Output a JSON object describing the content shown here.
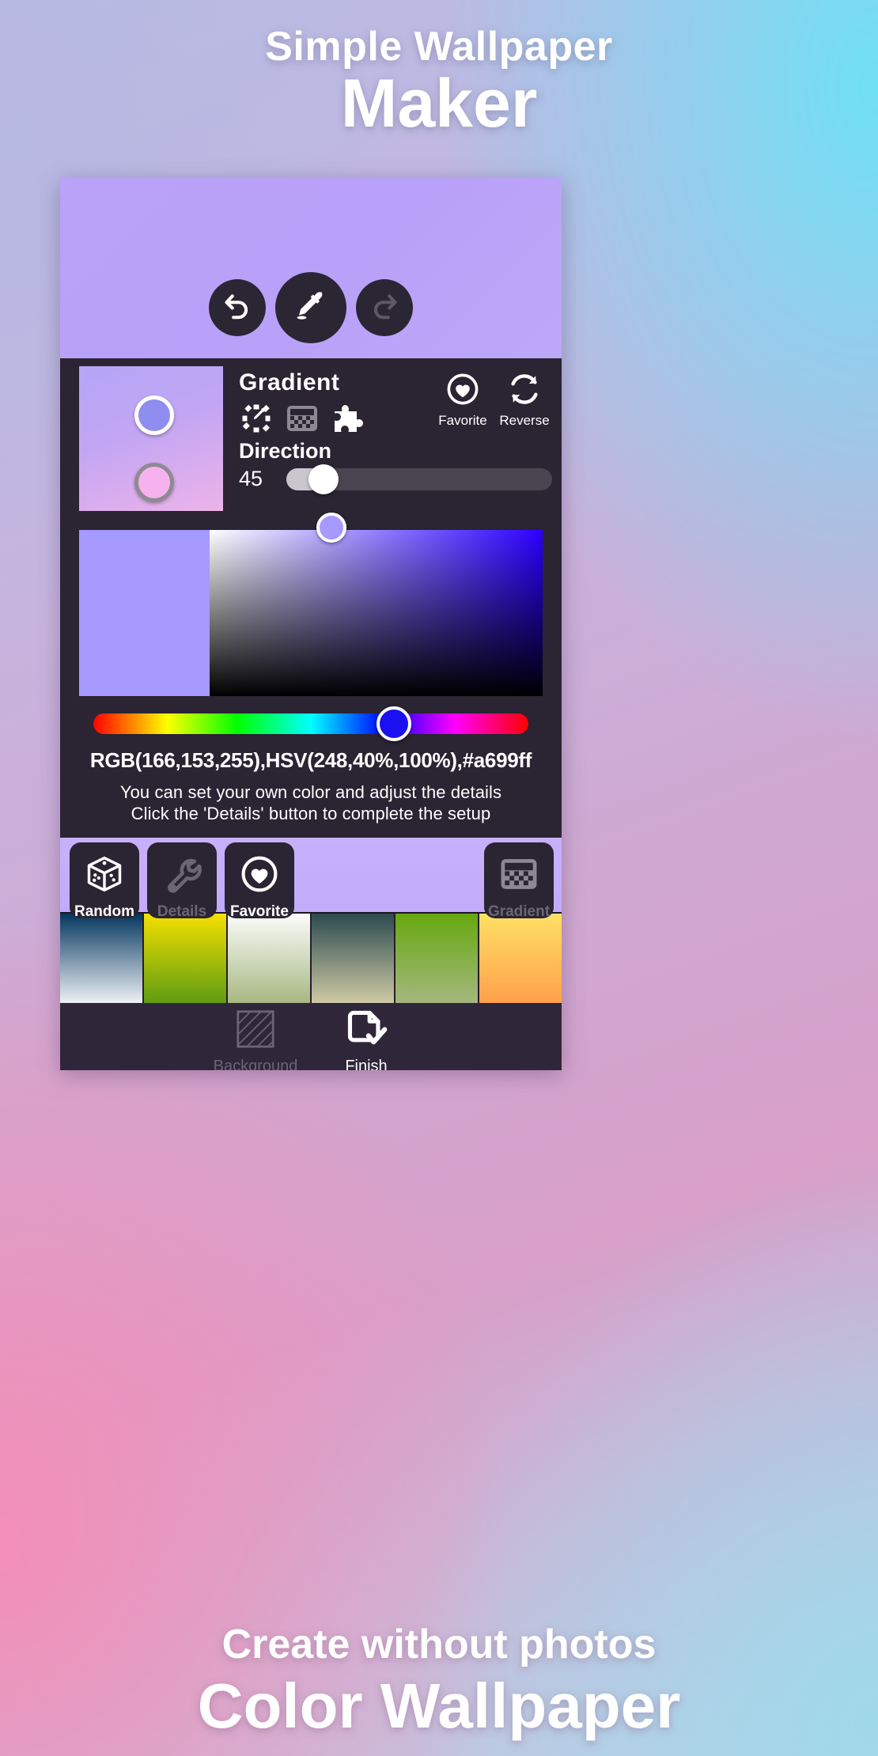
{
  "promo": {
    "heading_line1": "Simple Wallpaper",
    "heading_line2": "Maker",
    "footer_line1": "Create without photos",
    "footer_line2": "Color Wallpaper"
  },
  "preview": {
    "undo_icon": "undo-icon",
    "eyedropper_icon": "eyedropper-icon",
    "redo_icon": "redo-icon",
    "gradient_start": "#b9a2f7",
    "gradient_end": "#bda8f8"
  },
  "gradient_panel": {
    "title": "Gradient",
    "preview_start": "#b3a5f6",
    "preview_mid": "#c3a6f3",
    "preview_end": "#edb3e9",
    "stops": [
      {
        "name": "stop-color-1",
        "color": "#8f8df0",
        "selected": true
      },
      {
        "name": "stop-color-2",
        "color": "#f6b2ef",
        "selected": false
      }
    ],
    "mode_icons": [
      "color-wheel-picker-icon",
      "checkerboard-icon",
      "puzzle-piece-icon"
    ],
    "actions": [
      {
        "label": "Favorite",
        "icon": "heart-circle-icon"
      },
      {
        "label": "Reverse",
        "icon": "reverse-arrows-icon"
      }
    ],
    "direction": {
      "label": "Direction",
      "value": "45",
      "percent": 14
    }
  },
  "color_picker": {
    "current_color": "#a699ff",
    "sv_knob_x_percent": 32,
    "hue_knob_percent": 69,
    "hue_knob_color": "#1a10f0",
    "readout": "RGB(166,153,255),HSV(248,40%,100%),#a699ff",
    "hint_line1": "You can set your own color and adjust the details",
    "hint_line2": "Click the 'Details' button to complete the setup"
  },
  "action_bar": {
    "buttons": [
      {
        "label": "Random",
        "icon": "dice-icon",
        "enabled": true
      },
      {
        "label": "Details",
        "icon": "wrench-icon",
        "enabled": false
      },
      {
        "label": "Favorite",
        "icon": "heart-circle-icon",
        "enabled": true
      }
    ],
    "right_button": {
      "label": "Gradient",
      "icon": "checkerboard-icon",
      "enabled": false
    }
  },
  "palette": {
    "swatches": [
      {
        "name": "swatch-blue-white",
        "top": "#04365f",
        "bottom": "#eef1f4"
      },
      {
        "name": "swatch-yellow-green",
        "top": "#f5e000",
        "bottom": "#5f9d12"
      },
      {
        "name": "swatch-white-olive",
        "top": "#fbfcfb",
        "bottom": "#a8b882"
      },
      {
        "name": "swatch-teal-sand",
        "top": "#2b4a4e",
        "bottom": "#cec9a4"
      },
      {
        "name": "swatch-green-sage",
        "top": "#66a80f",
        "bottom": "#a4b77e"
      },
      {
        "name": "swatch-yellow-orange",
        "top": "#ffe066",
        "bottom": "#ffa04a"
      }
    ]
  },
  "bottom_bar": {
    "buttons": [
      {
        "label": "Background",
        "icon": "hatched-square-icon",
        "enabled": false
      },
      {
        "label": "Finish",
        "icon": "document-check-icon",
        "enabled": true
      }
    ]
  }
}
